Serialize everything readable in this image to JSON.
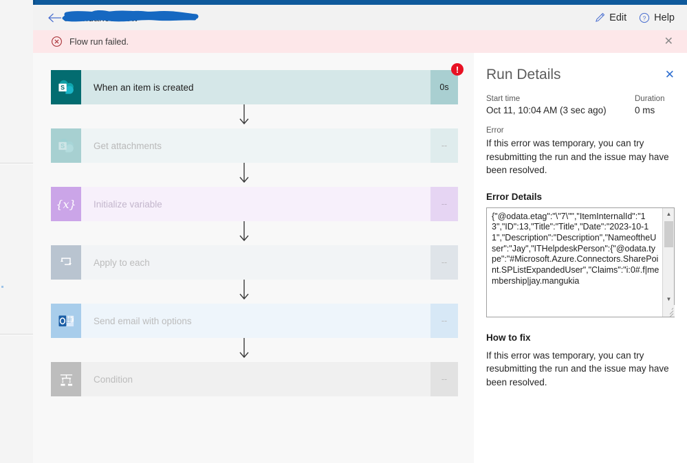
{
  "window": {
    "titlebar_color": "#0f5a9c"
  },
  "header": {
    "back_label": "back-arrow",
    "flow_title": "Attendance Flow",
    "title_redacted": true,
    "redaction_color": "#1668c1",
    "edit_label": "Edit",
    "help_label": "Help"
  },
  "banner": {
    "message": "Flow run failed.",
    "close_label": "✕",
    "background": "#fde7e9",
    "icon_color": "#a4262c"
  },
  "flow": {
    "steps": [
      {
        "name": "When an item is created",
        "duration": "0s",
        "state": "failed",
        "icon": "sharepoint-icon",
        "style": "active",
        "has_error_badge": true,
        "error_badge": "!"
      },
      {
        "name": "Get attachments",
        "duration": "--",
        "state": "skipped",
        "icon": "sharepoint-icon",
        "style": "sp-dim",
        "has_error_badge": false,
        "error_badge": ""
      },
      {
        "name": "Initialize variable",
        "duration": "--",
        "state": "skipped",
        "icon": "variable-icon",
        "style": "var",
        "has_error_badge": false,
        "error_badge": ""
      },
      {
        "name": "Apply to each",
        "duration": "--",
        "state": "skipped",
        "icon": "loop-icon",
        "style": "ctrl",
        "has_error_badge": false,
        "error_badge": ""
      },
      {
        "name": "Send email with options",
        "duration": "--",
        "state": "skipped",
        "icon": "outlook-icon",
        "style": "mail",
        "has_error_badge": false,
        "error_badge": ""
      },
      {
        "name": "Condition",
        "duration": "--",
        "state": "skipped",
        "icon": "condition-icon",
        "style": "cond",
        "has_error_badge": false,
        "error_badge": ""
      }
    ]
  },
  "details": {
    "title": "Run Details",
    "close_label": "✕",
    "start_time_label": "Start time",
    "start_time_value": "Oct 11, 10:04 AM (3 sec ago)",
    "duration_label": "Duration",
    "duration_value": "0 ms",
    "error_label": "Error",
    "error_body": "If this error was temporary, you can try resubmitting the run and the issue may have been resolved.",
    "error_details_title": "Error Details",
    "error_details_value": "{\"@odata.etag\":\"\\\"7\\\"\",\"ItemInternalId\":\"13\",\"ID\":13,\"Title\":\"Title\",\"Date\":\"2023-10-11\",\"Description\":\"Description\",\"NameoftheUser\":\"Jay\",\"ITHelpdeskPerson\":{\"@odata.type\":\"#Microsoft.Azure.Connectors.SharePoint.SPListExpandedUser\",\"Claims\":\"i:0#.f|membership|jay.mangukia",
    "how_to_fix_title": "How to fix",
    "how_to_fix_body": "If this error was temporary, you can try resubmitting the run and the issue may have been resolved."
  }
}
